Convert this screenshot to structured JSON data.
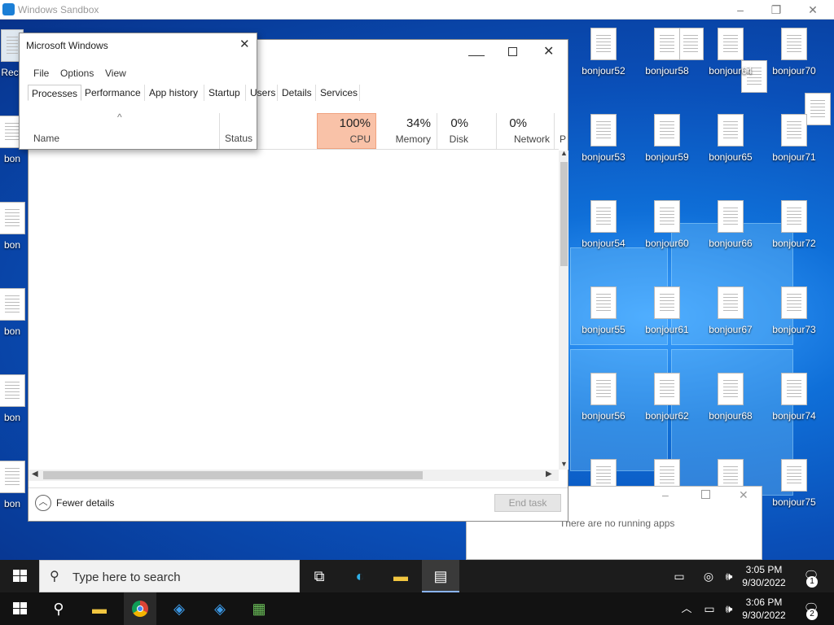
{
  "sandbox": {
    "title": "Windows Sandbox",
    "minimize": "–",
    "restore": "❐",
    "close": "✕"
  },
  "desktop": {
    "recycle_label": "Recy",
    "left_partial_labels": [
      "bon",
      "bon",
      "bon",
      "bon",
      "bon"
    ],
    "icons": [
      [
        "bonjour52",
        "bonjour58",
        "bonjour64",
        "bonjour70"
      ],
      [
        "bonjour53",
        "bonjour59",
        "bonjour65",
        "bonjour71"
      ],
      [
        "bonjour54",
        "bonjour60",
        "bonjour66",
        "bonjour72"
      ],
      [
        "bonjour55",
        "bonjour61",
        "bonjour67",
        "bonjour73"
      ],
      [
        "bonjour56",
        "bonjour62",
        "bonjour68",
        "bonjour74"
      ],
      [
        "",
        "",
        "",
        "bonjour75"
      ]
    ]
  },
  "taskmgr": {
    "menu": [
      "File",
      "Options",
      "View"
    ],
    "tabs": [
      "Processes",
      "Performance",
      "App history",
      "Startup",
      "Users",
      "Details",
      "Services"
    ],
    "columns": {
      "name": "Name",
      "status": "Status",
      "cpu_pct": "100%",
      "cpu": "CPU",
      "mem_pct": "34%",
      "mem": "Memory",
      "disk_pct": "0%",
      "disk": "Disk",
      "net_pct": "0%",
      "net": "Network",
      "partial": "P"
    },
    "fewer_details": "Fewer details",
    "end_task": "End task"
  },
  "dialog": {
    "title": "Microsoft Windows"
  },
  "popup": {
    "text": "There are no running apps"
  },
  "taskbar1": {
    "search_placeholder": "Type here to search",
    "time": "3:05 PM",
    "date": "9/30/2022",
    "notif_count": "1"
  },
  "taskbar2": {
    "time": "3:06 PM",
    "date": "9/30/2022",
    "notif_count": "2"
  }
}
